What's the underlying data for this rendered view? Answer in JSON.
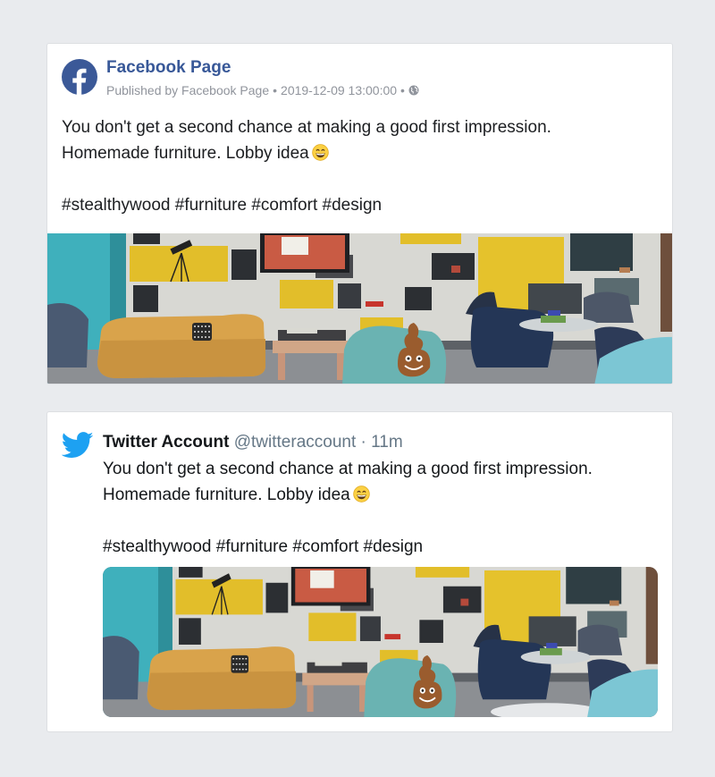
{
  "facebook": {
    "page_name": "Facebook Page",
    "published_by": "Published by Facebook Page",
    "bullet": "•",
    "timestamp": "2019-12-09 13:00:00",
    "line1": "You don't get a second chance at making a good first impression.",
    "line2": "Homemade furniture. Lobby idea",
    "hashtags": [
      "#stealthywood",
      "#furniture",
      "#comfort",
      "#design"
    ],
    "icons": {
      "logo": "facebook-logo-icon",
      "audience": "globe-icon",
      "emoji": "grinning-face-emoji"
    },
    "brand_color": "#385898"
  },
  "twitter": {
    "account_name": "Twitter Account",
    "handle": "@twitteraccount",
    "separator": "·",
    "time": "11m",
    "line1": "You don't get a second chance at making a good first impression.",
    "line2": "Homemade furniture. Lobby idea",
    "hashtags": [
      "#stealthywood",
      "#furniture",
      "#comfort",
      "#design"
    ],
    "icons": {
      "logo": "twitter-bird-icon",
      "emoji": "grinning-face-emoji"
    },
    "brand_color": "#1da1f2"
  }
}
